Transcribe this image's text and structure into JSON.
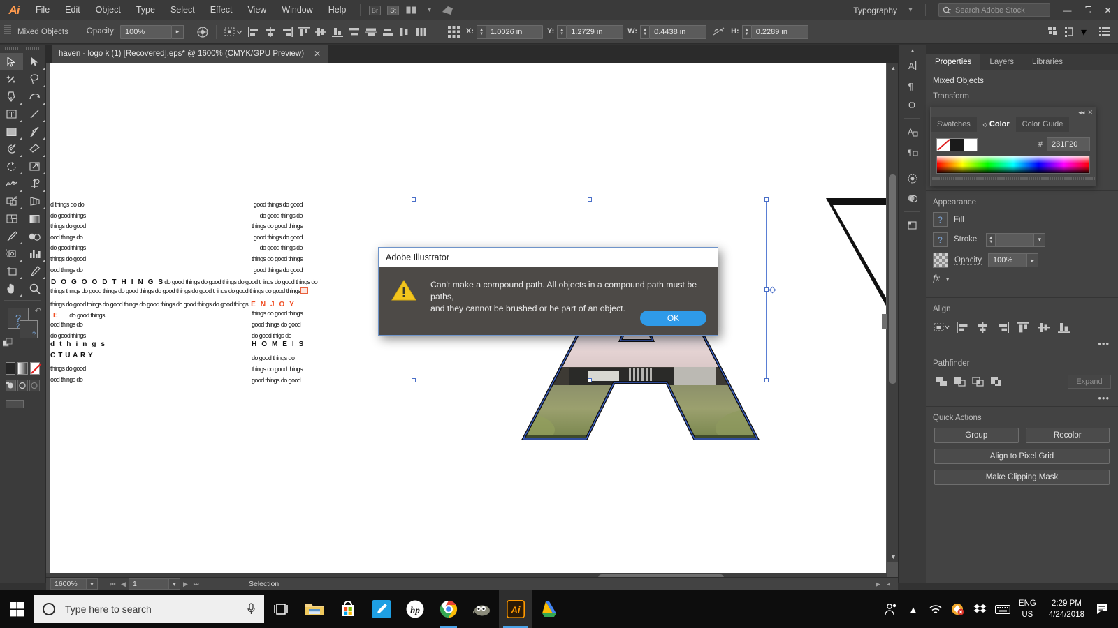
{
  "app": {
    "name": "Adobe Illustrator",
    "logo": "Ai",
    "menus": [
      "File",
      "Edit",
      "Object",
      "Type",
      "Select",
      "Effect",
      "View",
      "Window",
      "Help"
    ],
    "bridge_badge": "Br",
    "stock_badge": "St",
    "workspace": "Typography",
    "search_placeholder": "Search Adobe Stock",
    "window_buttons": {
      "minimize": "—",
      "restore": "❐",
      "close": "✕"
    }
  },
  "controlbar": {
    "selection_label": "Mixed Objects",
    "opacity_label": "Opacity:",
    "opacity_value": "100%",
    "x_label": "X:",
    "x_value": "1.0026 in",
    "y_label": "Y:",
    "y_value": "1.2729 in",
    "w_label": "W:",
    "w_value": "0.4438 in",
    "h_label": "H:",
    "h_value": "0.2289 in"
  },
  "document": {
    "tab_title": "haven - logo k (1) [Recovered].eps* @ 1600% (CMYK/GPU Preview)",
    "close_glyph": "✕"
  },
  "artwork": {
    "tiny_line_a": "good things do do",
    "tiny_line_b": "do good things",
    "tiny_line_c": "things do good",
    "tiny_line_d": "good things do",
    "headline_1": "D O  G O O D  T H I N G S",
    "headline_2": "E N J O Y",
    "headline_3": "E",
    "headline_4": "d t h i n g s",
    "headline_5": "C T U A R Y",
    "headline_6": "H O M E    I S",
    "left_lines": [
      "d things do do",
      "do good things",
      "things do good",
      "ood things do",
      "do good things",
      "things do good",
      "ood things do"
    ],
    "right_lines": [
      "good things do good",
      "do good things do",
      "things do good things",
      "good things do good",
      "do good things do",
      "things do good things",
      "good things do good"
    ],
    "run_line": "do good things do good things do good things do good things do",
    "run_line_2": "things things do good things do good things do good things do good things do good things do good things do",
    "run_line_3": "things do good things do good things do good things do good things do good things",
    "lower_left": [
      "ood things do",
      "do good things",
      "d t h i n g s",
      "C T U A R Y",
      "things do good",
      "ood things do"
    ],
    "lower_right": [
      "things do good things",
      "good things do good",
      "do good  thigs  do",
      "H O M E    I S",
      "do good things do",
      "things do good things",
      "good things do good"
    ]
  },
  "dialog": {
    "title": "Adobe Illustrator",
    "message_line_1": "Can't make a compound path. All objects in a compound path must be paths,",
    "message_line_2": "and they cannot be brushed or be part of an object.",
    "ok_label": "OK",
    "icon": "warning-triangle-icon"
  },
  "properties": {
    "tabs": [
      {
        "label": "Properties",
        "active": true
      },
      {
        "label": "Layers",
        "active": false
      },
      {
        "label": "Libraries",
        "active": false
      }
    ],
    "selection_type": "Mixed Objects",
    "transform_title": "Transform",
    "appearance_title": "Appearance",
    "fill_label": "Fill",
    "stroke_label": "Stroke",
    "stroke_weight": "",
    "opacity_label": "Opacity",
    "opacity_value": "100%",
    "fx_label": "fx",
    "align_title": "Align",
    "pathfinder_title": "Pathfinder",
    "expand_label": "Expand",
    "quick_actions_title": "Quick Actions",
    "quick_actions": [
      "Group",
      "Recolor",
      "Align to Pixel Grid",
      "Make Clipping Mask"
    ],
    "more_glyph": "•••"
  },
  "color_panel": {
    "tabs": [
      {
        "label": "Swatches",
        "active": false
      },
      {
        "label": "Color",
        "active": true
      },
      {
        "label": "Color Guide",
        "active": false
      }
    ],
    "hash_label": "#",
    "hex_value": "231F20",
    "none_swatch": "none-swatch",
    "fill_swatch": "#231F20",
    "stroke_swatch": "#FFFFFF"
  },
  "statusbar": {
    "zoom_value": "1600%",
    "artboard_number": "1",
    "tool_status": "Selection",
    "nav_first": "⏮",
    "nav_prev": "◀",
    "nav_next": "▶",
    "nav_last": "⏭"
  },
  "toolbar": {
    "tools": [
      "selection-tool",
      "direct-selection-tool",
      "magic-wand-tool",
      "lasso-tool",
      "pen-tool",
      "curvature-tool",
      "type-tool",
      "line-segment-tool",
      "rectangle-tool",
      "paintbrush-tool",
      "shaper-tool",
      "eraser-tool",
      "rotate-tool",
      "scale-tool",
      "width-tool",
      "free-transform-tool",
      "shape-builder-tool",
      "perspective-grid-tool",
      "mesh-tool",
      "gradient-tool",
      "eyedropper-tool",
      "blend-tool",
      "symbol-sprayer-tool",
      "column-graph-tool",
      "artboard-tool",
      "slice-tool",
      "hand-tool",
      "zoom-tool"
    ],
    "fill_color": "#231F20",
    "stroke_color": "none",
    "color_mode_swatches": [
      "color-swatch",
      "gradient-swatch",
      "none-swatch"
    ],
    "draw_modes": [
      "draw-normal",
      "draw-behind",
      "draw-inside"
    ]
  },
  "taskbar": {
    "start": "windows-start-icon",
    "search_placeholder": "Type here to search",
    "mic": "microphone-icon",
    "task_view": "task-view-icon",
    "apps": [
      "file-explorer-icon",
      "microsoft-store-icon",
      "blue-pen-app-icon",
      "hp-icon",
      "google-chrome-icon",
      "gimp-icon",
      "adobe-illustrator-icon",
      "google-drive-icon"
    ],
    "tray": [
      "people-icon",
      "show-hidden-icons-chevron",
      "wifi-icon",
      "security-alert-icon",
      "dropbox-icon",
      "keyboard-icon"
    ],
    "language": "ENG",
    "region": "US",
    "time": "2:29 PM",
    "date": "4/24/2018",
    "action_center": "action-center-icon"
  },
  "colors": {
    "accent_blue": "#2f9ae8",
    "selection_blue": "#4a6fc8",
    "orange_text": "#f04e23",
    "warning_yellow": "#f5c518",
    "panel_bg": "#434343",
    "chrome_bg": "#3a3a3a"
  }
}
